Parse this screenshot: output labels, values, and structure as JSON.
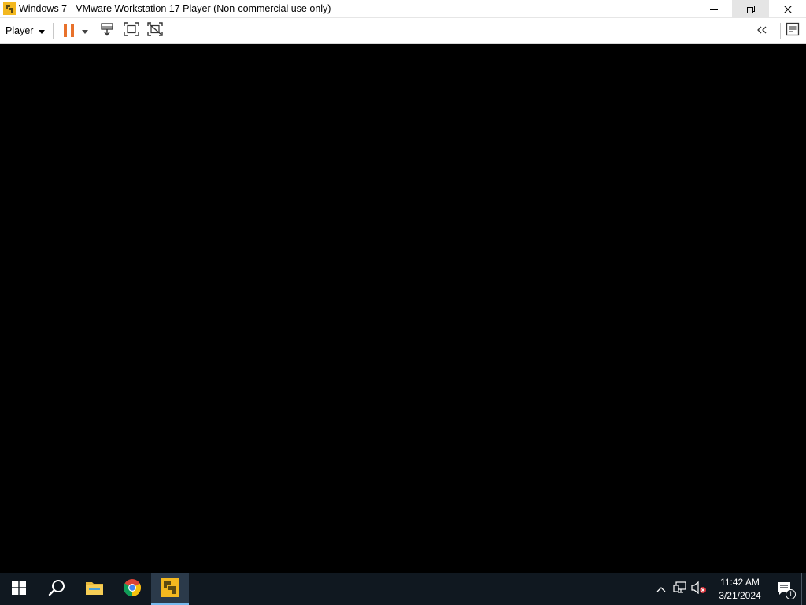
{
  "window": {
    "title": "Windows 7 - VMware Workstation 17 Player (Non-commercial use only)"
  },
  "toolbar": {
    "player_label": "Player"
  },
  "taskbar": {
    "time": "11:42 AM",
    "date": "3/21/2024",
    "notification_count": "1"
  },
  "colors": {
    "pause_orange": "#e8712b",
    "vmware_yellow": "#f3b81f",
    "taskbar_bg": "#101820"
  }
}
